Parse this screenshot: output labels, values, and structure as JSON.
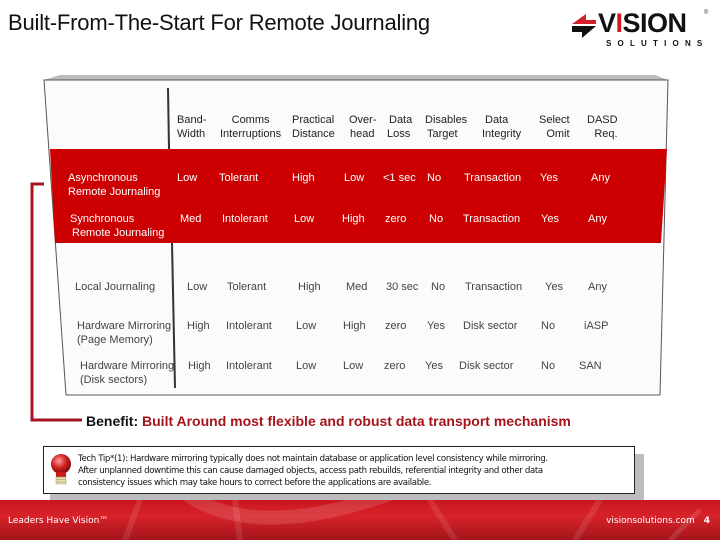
{
  "slide": {
    "title": "Built-From-The-Start For Remote Journaling",
    "logo": {
      "word_prefix": "V",
      "word_i": "I",
      "word_rest": "SION",
      "sub": "SOLUTIONS",
      "reg": "®"
    },
    "colors": {
      "accent_red": "#cc0000",
      "bracket_red": "#a5141c",
      "footer_red": "#c8161e"
    }
  },
  "table": {
    "headers": [
      [
        "Band-",
        "Width"
      ],
      [
        "Comms",
        "Interruptions"
      ],
      [
        "Practical",
        "Distance"
      ],
      [
        "Over-",
        "head"
      ],
      [
        "Data",
        "Loss"
      ],
      [
        "Disables",
        "Target"
      ],
      [
        "Data",
        "Integrity"
      ],
      [
        "Select",
        "Omit"
      ],
      [
        "DASD",
        "Req."
      ]
    ],
    "rows": [
      {
        "label": [
          "Asynchronous",
          "Remote Journaling"
        ],
        "highlight": true,
        "cells": [
          "Low",
          "Tolerant",
          "High",
          "Low",
          "<1 sec",
          "No",
          "Transaction",
          "Yes",
          "Any"
        ]
      },
      {
        "label": [
          "Synchronous",
          "Remote Journaling"
        ],
        "highlight": true,
        "cells": [
          "Med",
          "Intolerant",
          "Low",
          "High",
          "zero",
          "No",
          "Transaction",
          "Yes",
          "Any"
        ]
      },
      {
        "label": [
          "Local Journaling",
          ""
        ],
        "highlight": false,
        "cells": [
          "Low",
          "Tolerant",
          "High",
          "Med",
          "30 sec",
          "No",
          "Transaction",
          "Yes",
          "Any"
        ]
      },
      {
        "label": [
          "Hardware Mirroring",
          "(Page Memory)"
        ],
        "highlight": false,
        "cells": [
          "High",
          "Intolerant",
          "Low",
          "High",
          "zero",
          "Yes",
          "Disk sector",
          "No",
          "iASP"
        ]
      },
      {
        "label": [
          "Hardware Mirroring",
          "(Disk sectors)"
        ],
        "highlight": false,
        "cells": [
          "High",
          "Intolerant",
          "Low",
          "Low",
          "zero",
          "Yes",
          "Disk sector",
          "No",
          "SAN"
        ]
      }
    ]
  },
  "benefit": {
    "label": "Benefit:",
    "text": "Built Around most flexible and robust data transport mechanism"
  },
  "tech_tip": {
    "icon": "lightbulb-icon",
    "lines": [
      "Tech Tip*(1): Hardware mirroring typically does not maintain database or application level consistency while mirroring.",
      "After  unplanned downtime this can cause damaged objects, access path rebuilds, referential integrity and other data",
      "consistency issues which may take hours to correct before the applications are available."
    ]
  },
  "footer": {
    "tagline": "Leaders Have Vision™",
    "website": "visionsolutions.com",
    "page_number": "4"
  }
}
